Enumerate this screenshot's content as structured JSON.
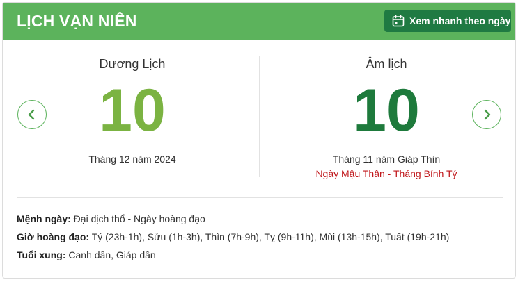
{
  "header": {
    "title": "LỊCH VẠN NIÊN",
    "quick_view_label": "Xem nhanh theo ngày",
    "quick_view_icon": "calendar-icon"
  },
  "colors": {
    "header_bg": "#5cb35c",
    "button_bg": "#1f7a42",
    "solar_day": "#7bb342",
    "lunar_day": "#1e7a3c",
    "lunar_note": "#c0171b"
  },
  "solar": {
    "title": "Dương Lịch",
    "day": "10",
    "month_year": "Tháng 12 năm 2024"
  },
  "lunar": {
    "title": "Âm lịch",
    "day": "10",
    "month_year": "Tháng 11 năm Giáp Thìn",
    "can_chi": "Ngày Mậu Thân - Tháng Bính Tý"
  },
  "nav": {
    "prev_icon": "chevron-left-icon",
    "next_icon": "chevron-right-icon"
  },
  "details": {
    "menh_label": "Mệnh ngày:",
    "menh_value": " Đại dịch thổ - Ngày hoàng đạo",
    "gio_label": "Giờ hoàng đạo:",
    "gio_value": " Tý (23h-1h), Sửu (1h-3h), Thìn (7h-9h), Tỵ (9h-11h), Mùi (13h-15h), Tuất (19h-21h)",
    "tuoi_label": "Tuổi xung:",
    "tuoi_value": " Canh dần, Giáp dần"
  }
}
